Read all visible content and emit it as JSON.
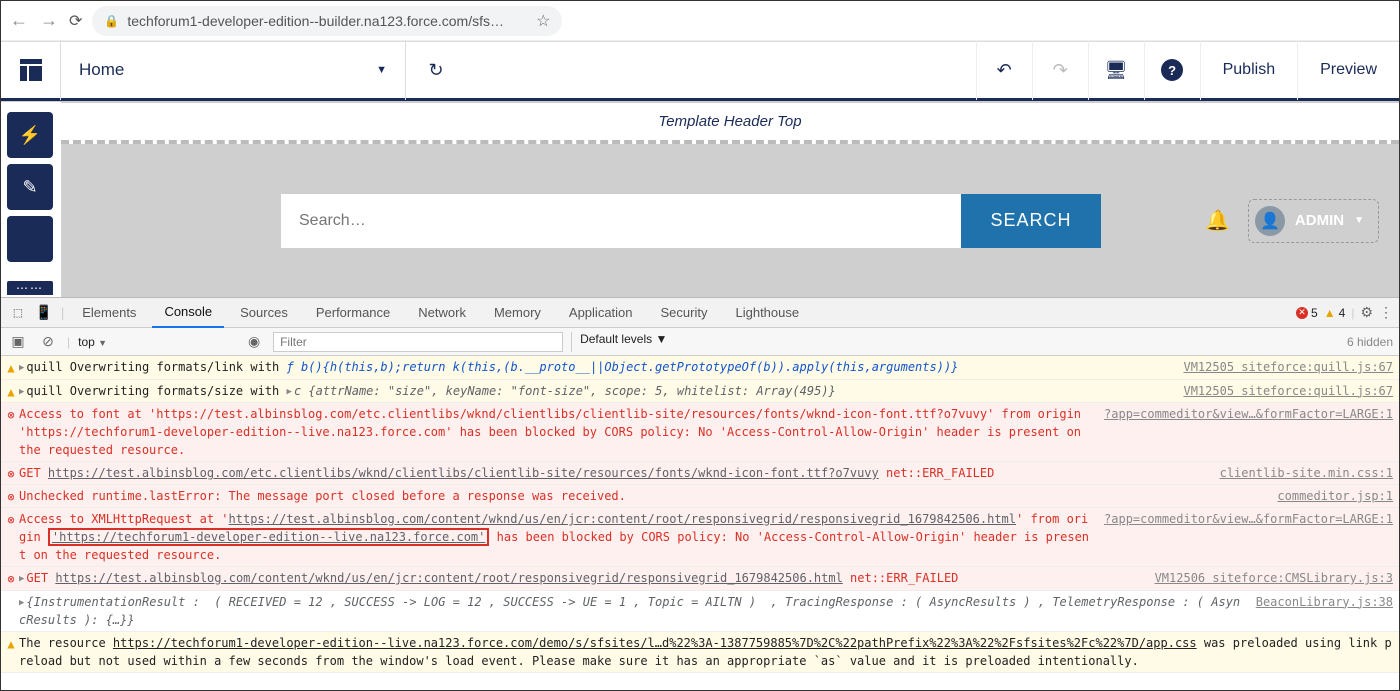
{
  "browser": {
    "url": "techforum1-developer-edition--builder.na123.force.com/sfs…"
  },
  "builder": {
    "page_label": "Home",
    "publish": "Publish",
    "preview": "Preview"
  },
  "canvas": {
    "template_header": "Template Header Top",
    "search_placeholder": "Search…",
    "search_button": "SEARCH",
    "admin_label": "ADMIN"
  },
  "devtools": {
    "tabs": [
      "Elements",
      "Console",
      "Sources",
      "Performance",
      "Network",
      "Memory",
      "Application",
      "Security",
      "Lighthouse"
    ],
    "active_tab": "Console",
    "error_count": "5",
    "warn_count": "4",
    "context": "top",
    "filter_placeholder": "Filter",
    "levels": "Default levels ▼",
    "hidden": "6 hidden"
  },
  "log": {
    "r0_a": "quill Overwriting formats/link with ",
    "r0_b": "ƒ b(){h(this,b);return k(this,(b.__proto__||Object.getPrototypeOf(b)).apply(this,arguments))}",
    "r0_src": "VM12505 siteforce:quill.js:67",
    "r1_a": "quill Overwriting formats/size with ",
    "r1_b": "c {attrName: \"size\", keyName: \"font-size\", scope: 5, whitelist: Array(495)}",
    "r1_src": "VM12505 siteforce:quill.js:67",
    "r2": "Access to font at 'https://test.albinsblog.com/etc.clientlibs/wknd/clientlibs/clientlib-site/resources/fonts/wknd-icon-font.ttf?o7vuvy' from origin 'https://techforum1-developer-edition--live.na123.force.com' has been blocked by CORS policy: No 'Access-Control-Allow-Origin' header is present on the requested resource.",
    "r2_src": "?app=commeditor&view…&formFactor=LARGE:1",
    "r3_a": "GET ",
    "r3_b": "https://test.albinsblog.com/etc.clientlibs/wknd/clientlibs/clientlib-site/resources/fonts/wknd-icon-font.ttf?o7vuvy",
    "r3_c": " net::ERR_FAILED",
    "r3_src": "clientlib-site.min.css:1",
    "r4": "Unchecked runtime.lastError: The message port closed before a response was received.",
    "r4_src": "commeditor.jsp:1",
    "r5_a": "Access to XMLHttpRequest at '",
    "r5_b": "https://test.albinsblog.com/content/wknd/us/en/jcr:content/root/responsivegrid/responsivegrid_1679842506.html",
    "r5_c": "' from origin ",
    "r5_d": "'https://techforum1-developer-edition--live.na123.force.com'",
    "r5_e": " has been blocked by CORS policy: No 'Access-Control-Allow-Origin' header is present on the requested resource.",
    "r5_src": "?app=commeditor&view…&formFactor=LARGE:1",
    "r6_a": "GET ",
    "r6_b": "https://test.albinsblog.com/content/wknd/us/en/jcr:content/root/responsivegrid/responsivegrid_1679842506.html",
    "r6_c": " net::ERR_FAILED",
    "r6_src": "VM12506 siteforce:CMSLibrary.js:3",
    "r7": "{InstrumentationResult :  ( RECEIVED = 12 , SUCCESS -> LOG = 12 , SUCCESS -> UE = 1 , Topic = AILTN )  , TracingResponse : ( AsyncResults ) , TelemetryResponse : ( AsyncResults ): {…}}",
    "r7_src": "BeaconLibrary.js:38",
    "r8_a": "The resource ",
    "r8_b": "https://techforum1-developer-edition--live.na123.force.com/demo/s/sfsites/l…d%22%3A-1387759885%7D%2C%22pathPrefix%22%3A%22%2Fsfsites%2Fc%22%7D/app.css",
    "r8_c": " was preloaded using link preload but not used within a few seconds from the window's load event. Please make sure it has an appropriate `as` value and it is preloaded intentionally."
  }
}
